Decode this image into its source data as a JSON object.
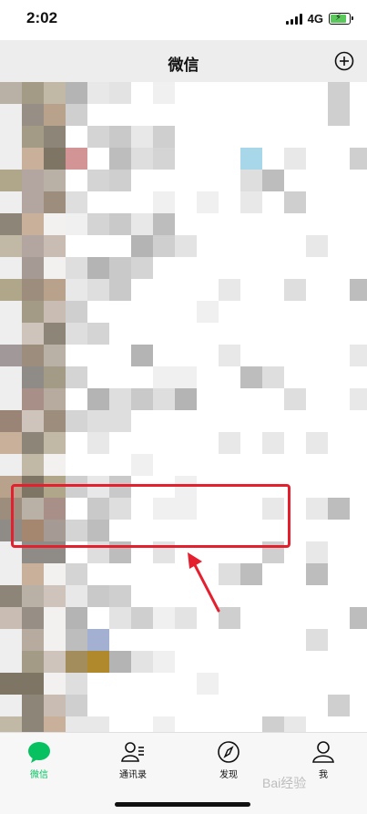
{
  "status_bar": {
    "time": "2:02",
    "network": "4G"
  },
  "nav": {
    "title": "微信",
    "add_icon": "plus-circle-icon"
  },
  "chat_list": {
    "state": "pixelated",
    "rows_visible": 29
  },
  "highlight_color": "#e5202e",
  "tabs": [
    {
      "label": "微信",
      "icon": "chat-bubble-icon",
      "active": true
    },
    {
      "label": "通讯录",
      "icon": "contacts-icon",
      "active": false
    },
    {
      "label": "发现",
      "icon": "compass-icon",
      "active": false
    },
    {
      "label": "我",
      "icon": "person-icon",
      "active": false
    }
  ],
  "accent_color": "#07c160",
  "watermark": "Bai经验"
}
